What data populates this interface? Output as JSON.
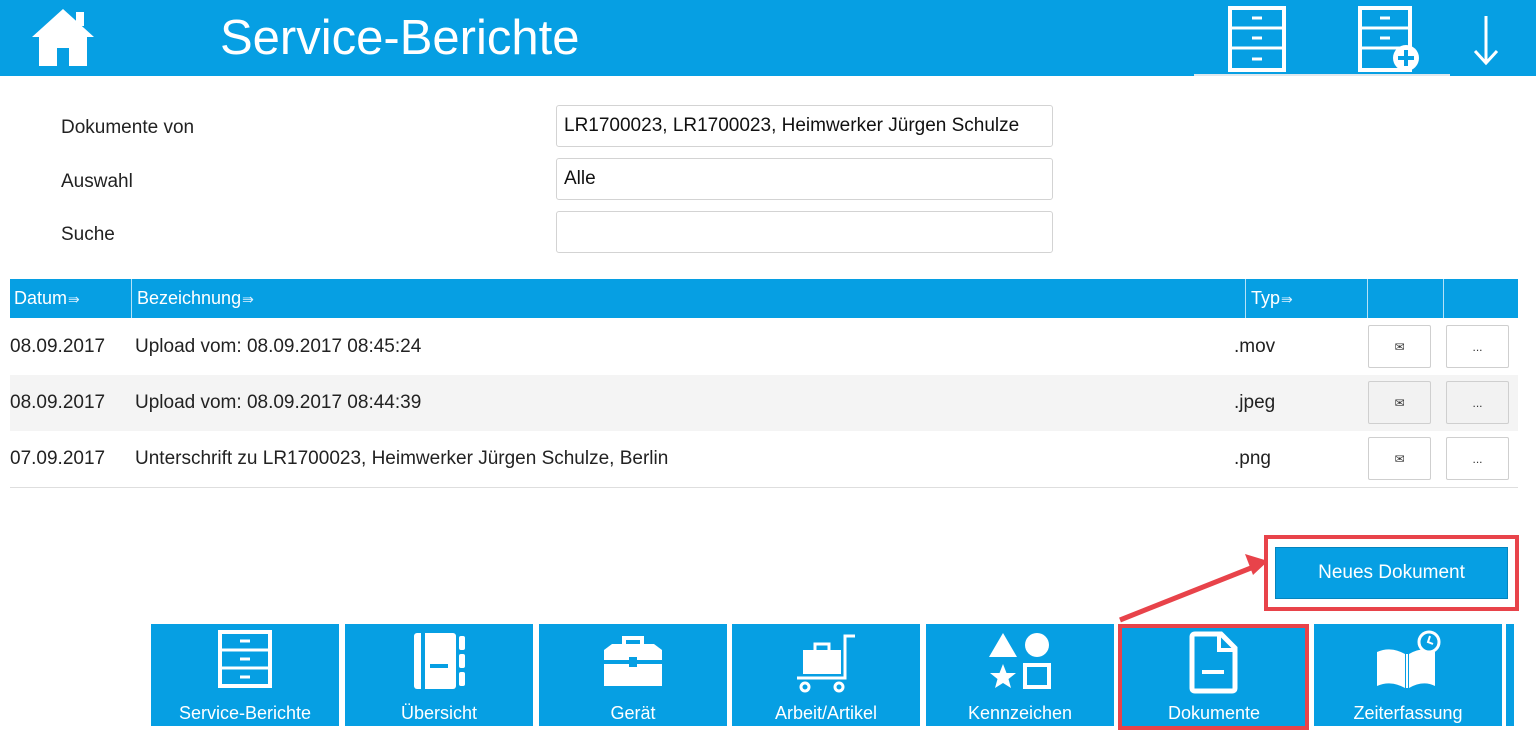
{
  "header": {
    "title": "Service-Berichte",
    "icons": [
      "home-icon",
      "cabinet-icon",
      "cabinet-add-icon",
      "arrow-down-icon"
    ],
    "bg_color": "#069fe3"
  },
  "form": {
    "documents_from_label": "Dokumente von",
    "documents_from_value": "LR1700023, LR1700023, Heimwerker Jürgen Schulze",
    "selection_label": "Auswahl",
    "selection_value": "Alle",
    "search_label": "Suche",
    "search_value": ""
  },
  "table": {
    "columns": [
      "Datum",
      "Bezeichnung",
      "Typ"
    ],
    "sort_icon": "⇛",
    "mail_icon": "✉",
    "more_label": "...",
    "rows": [
      {
        "date": "08.09.2017",
        "desc": "Upload vom: 08.09.2017 08:45:24",
        "type": ".mov"
      },
      {
        "date": "08.09.2017",
        "desc": "Upload vom: 08.09.2017 08:44:39",
        "type": ".jpeg"
      },
      {
        "date": "07.09.2017",
        "desc": "Unterschrift zu LR1700023, Heimwerker Jürgen Schulze, Berlin",
        "type": ".png"
      }
    ]
  },
  "new_document_label": "Neues Dokument",
  "nav": [
    {
      "label": "Service-Berichte",
      "icon": "cabinet-icon"
    },
    {
      "label": "Übersicht",
      "icon": "notebook-icon"
    },
    {
      "label": "Gerät",
      "icon": "toolbox-icon"
    },
    {
      "label": "Arbeit/Artikel",
      "icon": "cart-icon"
    },
    {
      "label": "Kennzeichen",
      "icon": "shapes-icon"
    },
    {
      "label": "Dokumente",
      "icon": "document-icon"
    },
    {
      "label": "Zeiterfassung",
      "icon": "book-clock-icon"
    }
  ],
  "highlight_color": "#e8434a"
}
